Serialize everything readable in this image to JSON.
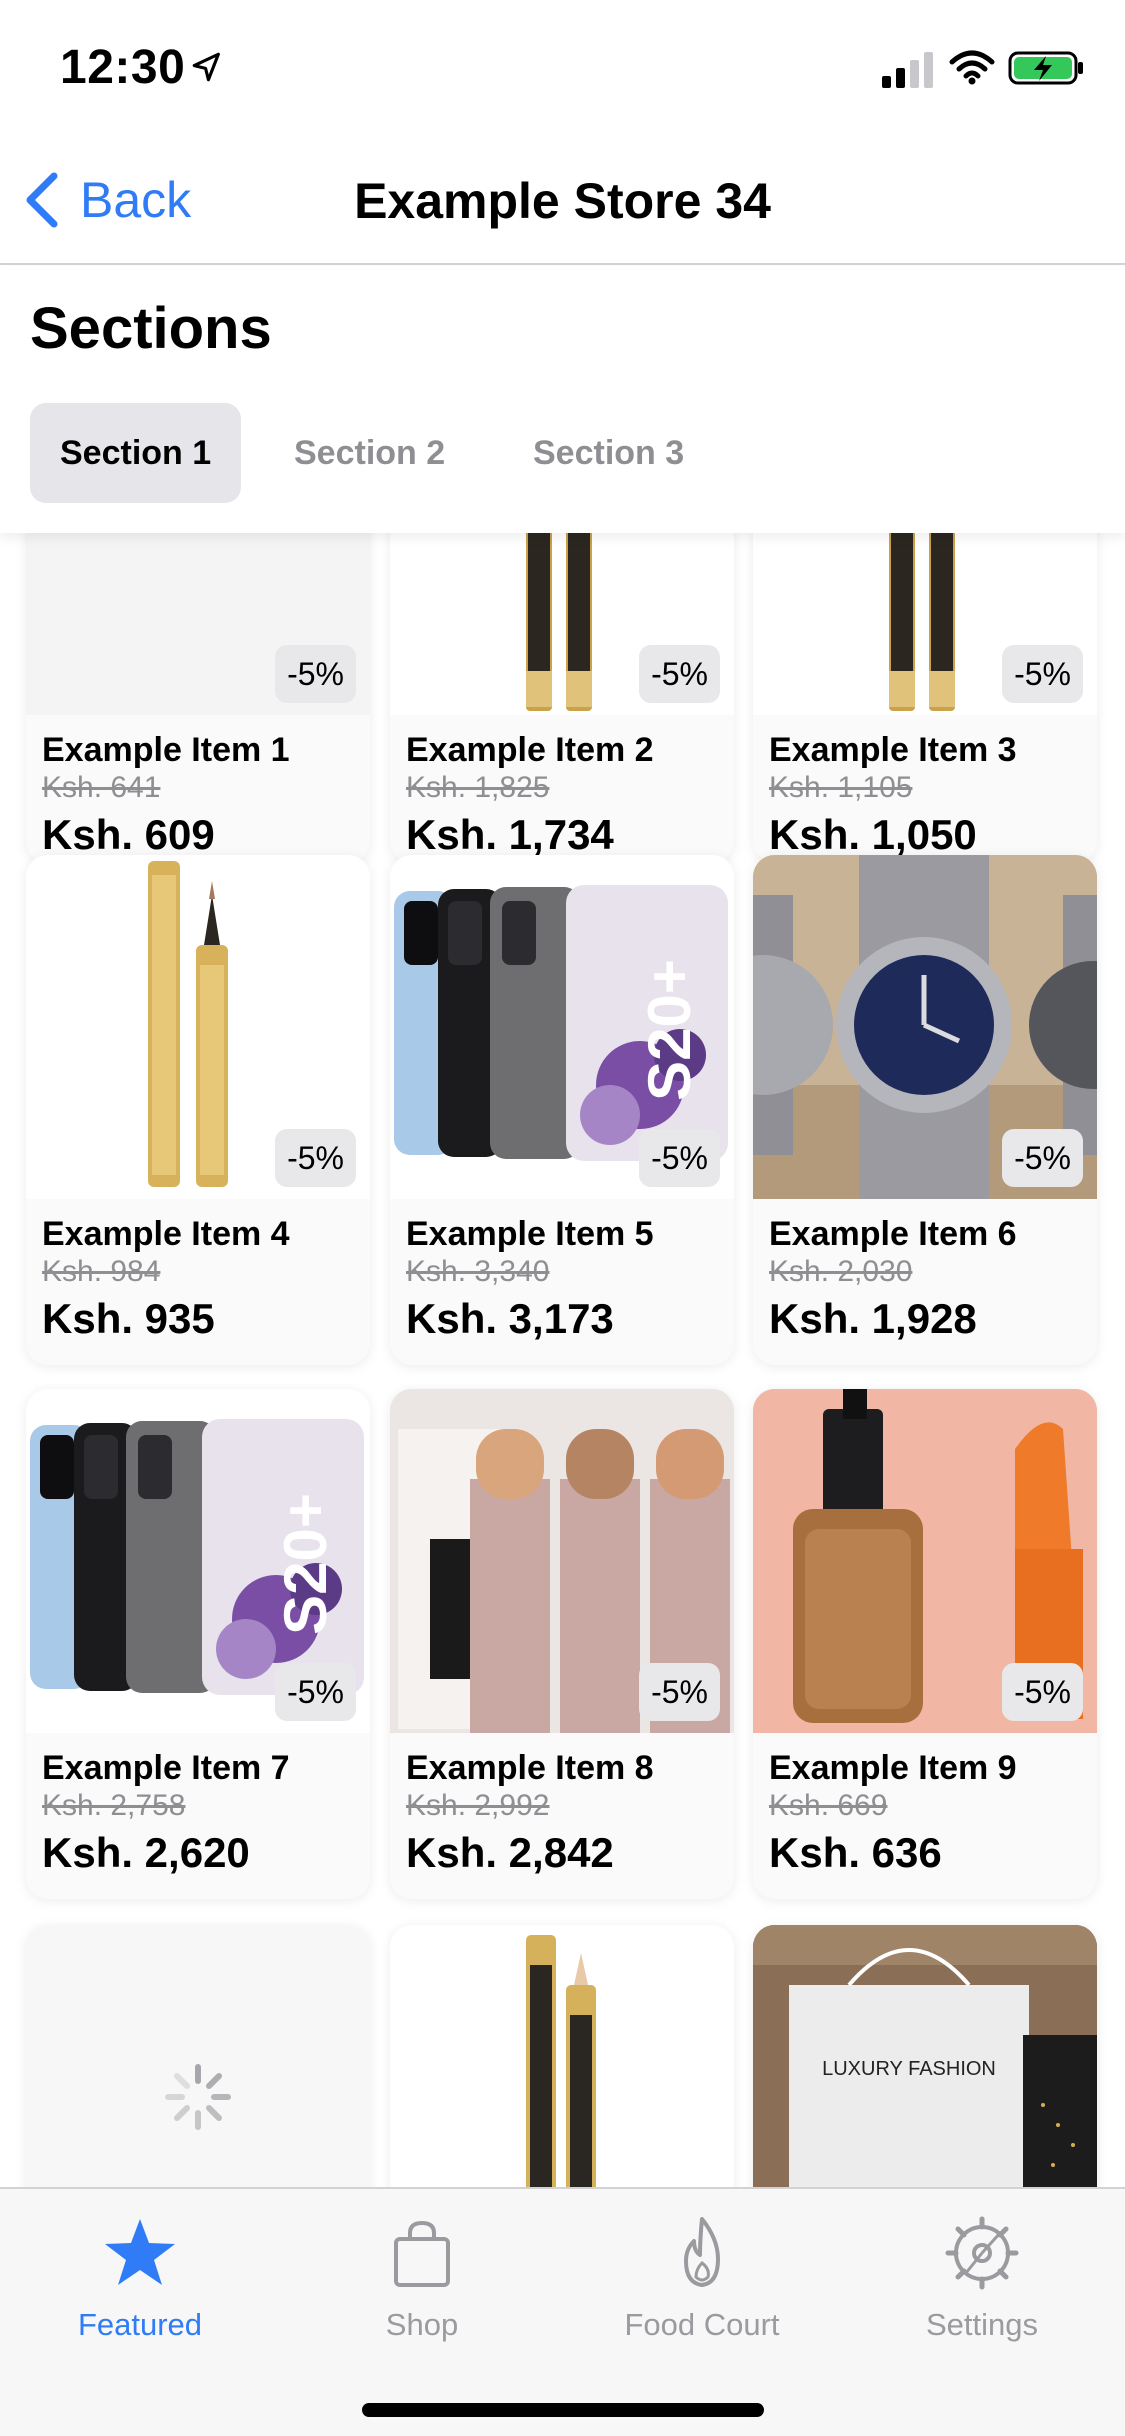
{
  "status_bar": {
    "time": "12:30"
  },
  "nav": {
    "back_label": "Back",
    "title": "Example Store 34"
  },
  "sections": {
    "heading": "Sections",
    "tabs": [
      {
        "label": "Section 1",
        "active": true
      },
      {
        "label": "Section 2",
        "active": false
      },
      {
        "label": "Section 3",
        "active": false
      }
    ]
  },
  "items": [
    {
      "name": "Example Item 1",
      "old_price": "Ksh. 641",
      "price": "Ksh. 609",
      "discount": "-5%",
      "image": "blank"
    },
    {
      "name": "Example Item 2",
      "old_price": "Ksh. 1,825",
      "price": "Ksh. 1,734",
      "discount": "-5%",
      "image": "concealer-pens"
    },
    {
      "name": "Example Item 3",
      "old_price": "Ksh. 1,105",
      "price": "Ksh. 1,050",
      "discount": "-5%",
      "image": "concealer-pens"
    },
    {
      "name": "Example Item 4",
      "old_price": "Ksh. 984",
      "price": "Ksh. 935",
      "discount": "-5%",
      "image": "concealer-pens"
    },
    {
      "name": "Example Item 5",
      "old_price": "Ksh. 3,340",
      "price": "Ksh. 3,173",
      "discount": "-5%",
      "image": "galaxy-s20-phones"
    },
    {
      "name": "Example Item 6",
      "old_price": "Ksh. 2,030",
      "price": "Ksh. 1,928",
      "discount": "-5%",
      "image": "wristwatches"
    },
    {
      "name": "Example Item 7",
      "old_price": "Ksh. 2,758",
      "price": "Ksh. 2,620",
      "discount": "-5%",
      "image": "galaxy-s20-phones"
    },
    {
      "name": "Example Item 8",
      "old_price": "Ksh. 2,992",
      "price": "Ksh. 2,842",
      "discount": "-5%",
      "image": "makeup-sticks"
    },
    {
      "name": "Example Item 9",
      "old_price": "Ksh. 669",
      "price": "Ksh. 636",
      "discount": "-5%",
      "image": "foundation-bottle"
    },
    {
      "image": "loading-spinner"
    },
    {
      "image": "concealer-pen"
    },
    {
      "image": "shopping-bag"
    }
  ],
  "image_text": {
    "phone_model": "S20+",
    "bag_text": "LUXURY FASHION"
  },
  "tab_bar": [
    {
      "label": "Featured",
      "icon": "star-icon",
      "active": true
    },
    {
      "label": "Shop",
      "icon": "bag-icon",
      "active": false
    },
    {
      "label": "Food Court",
      "icon": "flame-icon",
      "active": false
    },
    {
      "label": "Settings",
      "icon": "gear-icon",
      "active": false
    }
  ],
  "colors": {
    "accent": "#2f7cf6",
    "inactive": "#9a9a9f",
    "tab_active_bg": "#e5e5ea",
    "discount_bg": "#e8e8ea",
    "battery": "#34c759"
  }
}
